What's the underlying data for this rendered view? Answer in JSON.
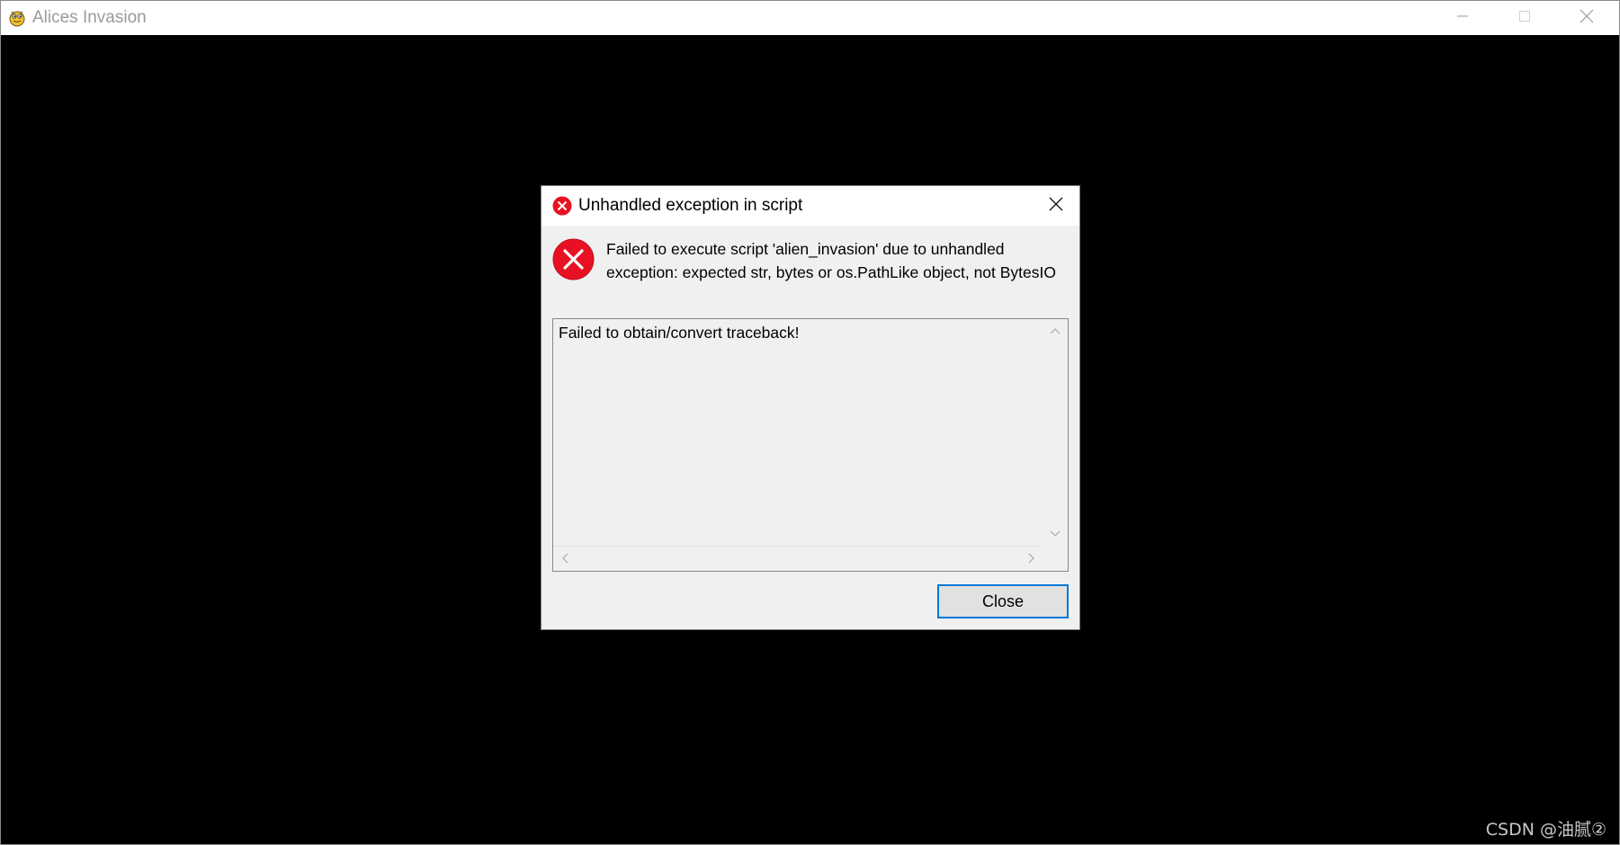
{
  "window": {
    "title": "Alices Invasion",
    "controls": {
      "minimize_icon": "minimize-icon",
      "maximize_icon": "maximize-icon",
      "close_icon": "close-icon"
    }
  },
  "dialog": {
    "title": "Unhandled exception in script",
    "message": "Failed to execute script 'alien_invasion' due to unhandled exception: expected str, bytes or os.PathLike object, not BytesIO",
    "traceback": "Failed to obtain/convert traceback!",
    "close_button_label": "Close",
    "error_color": "#e81123"
  },
  "watermark": "CSDN @油腻②"
}
